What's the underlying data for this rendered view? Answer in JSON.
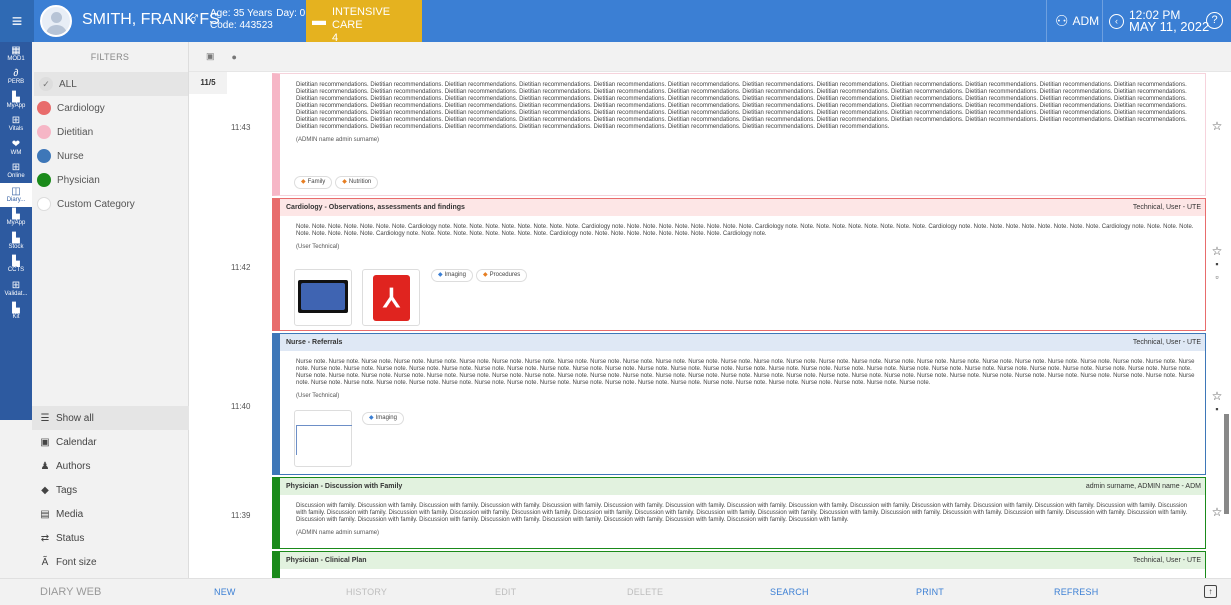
{
  "header": {
    "menu_icon": "hamburger-icon",
    "patient_name": "SMITH, FRANK FS",
    "sex_symbol": "♂",
    "age": "Age: 35 Years",
    "day": "Day: 0",
    "code": "Code: 443523",
    "ward_name": "INTENSIVE CARE",
    "ward_bed": "4",
    "user": "ADM",
    "time": "12:02 PM",
    "date": "MAY 11, 2022",
    "help": "?"
  },
  "rail": [
    {
      "label": "MOD1",
      "icon": "module-icon"
    },
    {
      "label": "PERB",
      "icon": "link-icon"
    },
    {
      "label": "MyApp",
      "icon": "app-icon"
    },
    {
      "label": "Vitals",
      "icon": "vitals-icon"
    },
    {
      "label": "WM",
      "icon": "heart-icon"
    },
    {
      "label": "Online",
      "icon": "online-icon"
    },
    {
      "label": "Diary...",
      "icon": "diary-icon"
    },
    {
      "label": "MyApp",
      "icon": "app-icon"
    },
    {
      "label": "Stock",
      "icon": "stock-icon"
    },
    {
      "label": "CCTS",
      "icon": "ccts-icon"
    },
    {
      "label": "Validat...",
      "icon": "validate-icon"
    },
    {
      "label": "Kit",
      "icon": "kit-icon"
    }
  ],
  "filters": {
    "title": "FILTERS",
    "all_label": "ALL",
    "categories": [
      {
        "label": "Cardiology",
        "color": "#e86c6c"
      },
      {
        "label": "Dietitian",
        "color": "#f6b6c6"
      },
      {
        "label": "Nurse",
        "color": "#3e77b8"
      },
      {
        "label": "Physician",
        "color": "#1a8a1a"
      },
      {
        "label": "Custom Category",
        "color": "#ffffff"
      }
    ],
    "tools": [
      {
        "label": "Show all",
        "icon": "filter-icon"
      },
      {
        "label": "Calendar",
        "icon": "calendar-icon"
      },
      {
        "label": "Authors",
        "icon": "person-icon"
      },
      {
        "label": "Tags",
        "icon": "tag-icon"
      },
      {
        "label": "Media",
        "icon": "media-icon"
      },
      {
        "label": "Status",
        "icon": "status-icon"
      },
      {
        "label": "Font size",
        "icon": "font-size-icon"
      }
    ]
  },
  "timeline": {
    "date": "11/5",
    "times": [
      "11:43",
      "11:42",
      "11:40",
      "11:39"
    ]
  },
  "notes": [
    {
      "category": "Dietitian",
      "color": "#f6b6c6",
      "title": "",
      "by": "",
      "body": "Dietitian recommendations. Dietitian recommendations. Dietitian recommendations. Dietitian recommendations. Dietitian recommendations. Dietitian recommendations. Dietitian recommendations. Dietitian recommendations. Dietitian recommendations. Dietitian recommendations. Dietitian recommendations. Dietitian recommendations. Dietitian recommendations. Dietitian recommendations. Dietitian recommendations. Dietitian recommendations. Dietitian recommendations. Dietitian recommendations. Dietitian recommendations. Dietitian recommendations. Dietitian recommendations. Dietitian recommendations. Dietitian recommendations. Dietitian recommendations. Dietitian recommendations. Dietitian recommendations. Dietitian recommendations. Dietitian recommendations. Dietitian recommendations. Dietitian recommendations. Dietitian recommendations. Dietitian recommendations. Dietitian recommendations. Dietitian recommendations. Dietitian recommendations. Dietitian recommendations. Dietitian recommendations. Dietitian recommendations. Dietitian recommendations. Dietitian recommendations. Dietitian recommendations. Dietitian recommendations. Dietitian recommendations. Dietitian recommendations. Dietitian recommendations. Dietitian recommendations. Dietitian recommendations. Dietitian recommendations. Dietitian recommendations. Dietitian recommendations. Dietitian recommendations. Dietitian recommendations. Dietitian recommendations. Dietitian recommendations. Dietitian recommendations. Dietitian recommendations. Dietitian recommendations. Dietitian recommendations. Dietitian recommendations. Dietitian recommendations. Dietitian recommendations. Dietitian recommendations. Dietitian recommendations. Dietitian recommendations. Dietitian recommendations. Dietitian recommendations. Dietitian recommendations. Dietitian recommendations. Dietitian recommendations. Dietitian recommendations. Dietitian recommendations. Dietitian recommendations. Dietitian recommendations. Dietitian recommendations. Dietitian recommendations. Dietitian recommendations. Dietitian recommendations. Dietitian recommendations. Dietitian recommendations. Dietitian recommendations.",
      "author": "(ADMIN name admin surname)",
      "tags": [
        "Family",
        "Nutrition"
      ]
    },
    {
      "category": "Cardiology",
      "color": "#e86c6c",
      "title": "Cardiology - Observations, assessments and findings",
      "by": "Technical, User - UTE",
      "body": "Note. Note. Note. Note. Note. Note. Note. Cardiology note. Note. Note. Note. Note. Note. Note. Note. Note. Cardiology note. Note. Note. Note. Note. Note. Note. Note. Note. Cardiology note. Note. Note. Note. Note. Note. Note. Note. Note. Cardiology note. Note. Note. Note. Note. Note. Note. Note. Note. Cardiology note. Note. Note. Note. Note. Note. Note. Note. Note. Cardiology note. Note. Note. Note. Note. Note. Note. Note. Note. Cardiology note. Note. Note. Note. Note. Note. Note. Note. Note. Cardiology note.",
      "author": "(User Technical)",
      "tags": [
        "Imaging",
        "Procedures"
      ]
    },
    {
      "category": "Nurse",
      "color": "#3e77b8",
      "title": "Nurse - Referrals",
      "by": "Technical, User - UTE",
      "body": "Nurse note. Nurse note. Nurse note. Nurse note. Nurse note. Nurse note. Nurse note. Nurse note. Nurse note. Nurse note. Nurse note. Nurse note. Nurse note. Nurse note. Nurse note. Nurse note. Nurse note. Nurse note. Nurse note. Nurse note. Nurse note. Nurse note. Nurse note. Nurse note. Nurse note. Nurse note. Nurse note. Nurse note. Nurse note. Nurse note. Nurse note. Nurse note. Nurse note. Nurse note. Nurse note. Nurse note. Nurse note. Nurse note. Nurse note. Nurse note. Nurse note. Nurse note. Nurse note. Nurse note. Nurse note. Nurse note. Nurse note. Nurse note. Nurse note. Nurse note. Nurse note. Nurse note. Nurse note. Nurse note. Nurse note. Nurse note. Nurse note. Nurse note. Nurse note. Nurse note. Nurse note. Nurse note. Nurse note. Nurse note. Nurse note. Nurse note. Nurse note. Nurse note. Nurse note. Nurse note. Nurse note. Nurse note. Nurse note. Nurse note. Nurse note. Nurse note. Nurse note. Nurse note. Nurse note. Nurse note. Nurse note. Nurse note. Nurse note. Nurse note. Nurse note. Nurse note. Nurse note. Nurse note. Nurse note. Nurse note. Nurse note. Nurse note. Nurse note. Nurse note. Nurse note. Nurse note. Nurse note. Nurse note. Nurse note. Nurse note. Nurse note. Nurse note.",
      "author": "(User Technical)",
      "tags": [
        "Imaging"
      ]
    },
    {
      "category": "Physician",
      "color": "#1a8a1a",
      "title": "Physician - Discussion with Family",
      "by": "admin surname, ADMIN name - ADM",
      "body": "Discussion with family. Discussion with family. Discussion with family. Discussion with family. Discussion with family. Discussion with family. Discussion with family. Discussion with family. Discussion with family. Discussion with family. Discussion with family. Discussion with family. Discussion with family. Discussion with family. Discussion with family. Discussion with family. Discussion with family. Discussion with family. Discussion with family. Discussion with family. Discussion with family. Discussion with family. Discussion with family. Discussion with family. Discussion with family. Discussion with family. Discussion with family. Discussion with family. Discussion with family. Discussion with family. Discussion with family. Discussion with family. Discussion with family. Discussion with family. Discussion with family. Discussion with family. Discussion with family. Discussion with family.",
      "author": "(ADMIN name admin surname)",
      "tags": []
    },
    {
      "category": "Physician",
      "color": "#1a8a1a",
      "title": "Physician - Clinical Plan",
      "by": "Technical, User - UTE",
      "body": "",
      "author": "",
      "tags": []
    }
  ],
  "footer": {
    "title": "DIARY WEB",
    "new": "NEW",
    "history": "HISTORY",
    "edit": "EDIT",
    "delete": "DELETE",
    "search": "SEARCH",
    "print": "PRINT",
    "refresh": "REFRESH"
  }
}
